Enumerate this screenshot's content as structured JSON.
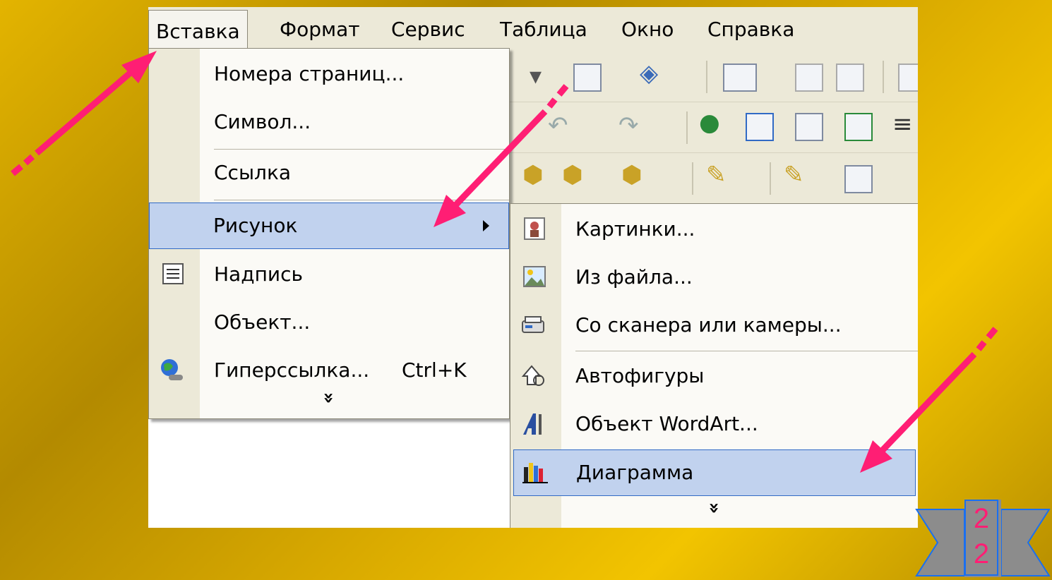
{
  "menubar": {
    "items": [
      {
        "label": "Вставка"
      },
      {
        "label": "Формат"
      },
      {
        "label": "Сервис"
      },
      {
        "label": "Таблица"
      },
      {
        "label": "Окно"
      },
      {
        "label": "Справка"
      }
    ]
  },
  "insert_menu": {
    "items": [
      {
        "label": "Номера страниц..."
      },
      {
        "label": "Символ..."
      },
      {
        "label": "Ссылка"
      },
      {
        "label": "Рисунок",
        "highlighted": true,
        "submenu": true
      },
      {
        "label": "Надпись",
        "icon": "text-box-icon"
      },
      {
        "label": "Объект..."
      },
      {
        "label": "Гиперссылка...",
        "shortcut": "Ctrl+K",
        "icon": "globe-link-icon"
      }
    ],
    "expand_glyph": "»"
  },
  "picture_submenu": {
    "items": [
      {
        "label": "Картинки...",
        "icon": "clipart-icon"
      },
      {
        "label": "Из файла...",
        "icon": "picture-from-file-icon"
      },
      {
        "label": "Со сканера или камеры...",
        "icon": "scanner-icon"
      },
      {
        "label": "Автофигуры",
        "icon": "autoshapes-icon"
      },
      {
        "label": "Объект WordArt...",
        "icon": "wordart-icon"
      },
      {
        "label": "Диаграмма",
        "icon": "chart-icon",
        "highlighted": true
      }
    ],
    "expand_glyph": "»"
  },
  "slide_badge": {
    "number": "22"
  },
  "colors": {
    "menu_highlight": "#c1d2ee",
    "highlight_border": "#316ac5",
    "arrow": "#ff1e74"
  }
}
